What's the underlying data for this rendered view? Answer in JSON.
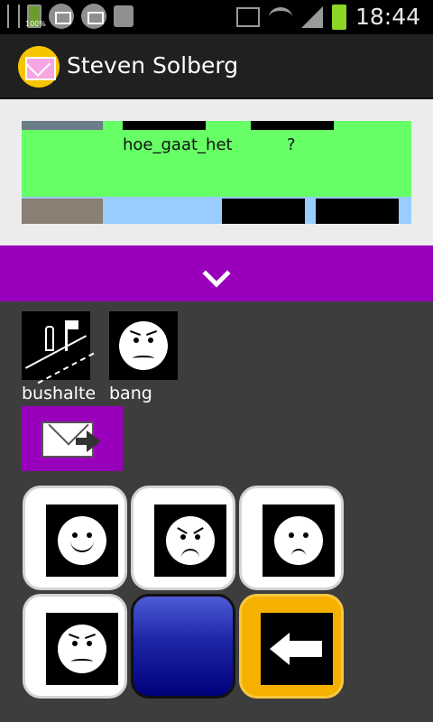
{
  "status_bar": {
    "battery_small_label": "100%",
    "clock": "18:44",
    "icons": [
      "usb-icon",
      "battery-icon",
      "mail-icon",
      "mail-icon",
      "clipboard-check-icon",
      "vibrate-icon",
      "wifi-icon",
      "signal-icon",
      "battery-icon"
    ]
  },
  "action_bar": {
    "title": "Steven Solberg",
    "icon": "mail-envelope-icon",
    "accent": "#f7c400"
  },
  "category_scroller": {
    "row1_color": "#66ff66",
    "row2_color": "#99ccff",
    "word_1": "hoe_gaat_het",
    "word_2": "?"
  },
  "collapse_bar": {
    "color": "#9900bb",
    "icon": "chevron-down-icon"
  },
  "sentence": {
    "items": [
      {
        "label": "bushalte",
        "icon": "bus-stop-icon"
      },
      {
        "label": "bang",
        "icon": "scared-face-icon"
      }
    ],
    "send_icon": "send-mail-icon"
  },
  "keys": [
    {
      "icon": "happy-face-icon"
    },
    {
      "icon": "angry-face-icon"
    },
    {
      "icon": "sad-face-icon"
    },
    {
      "icon": "worried-face-icon"
    },
    {
      "icon": "blank-key",
      "color": "#00007a"
    },
    {
      "icon": "back-arrow-icon",
      "color": "#f5b000"
    }
  ]
}
